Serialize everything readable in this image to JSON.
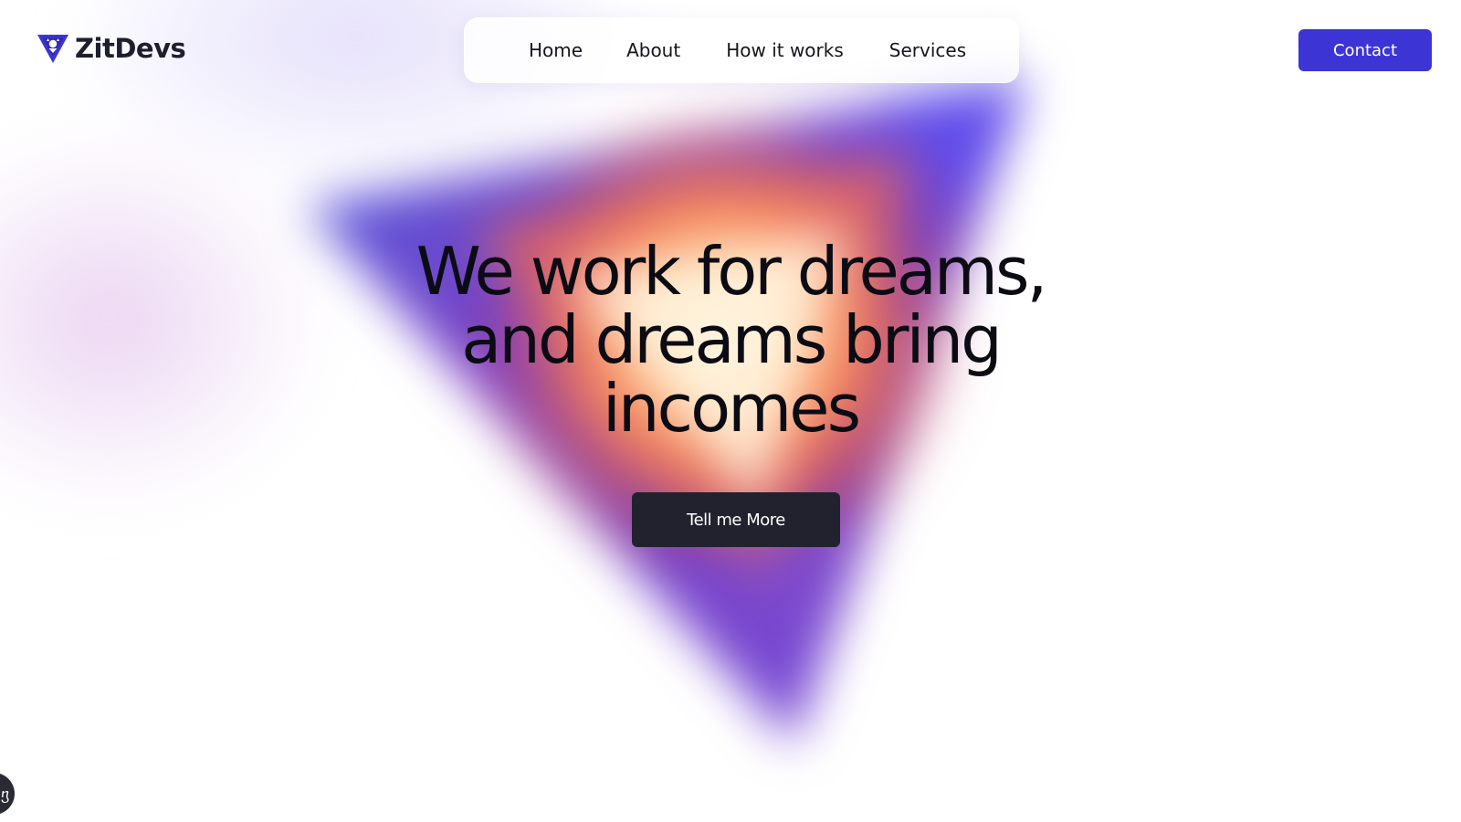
{
  "brand": {
    "name": "ZitDevs",
    "logo_icon": "inverted-triangle-logo-icon",
    "accent_color": "#3d34d6"
  },
  "nav": {
    "items": [
      {
        "label": "Home"
      },
      {
        "label": "About"
      },
      {
        "label": "How it works"
      },
      {
        "label": "Services"
      }
    ]
  },
  "header": {
    "contact_label": "Contact"
  },
  "hero": {
    "headline_lines": [
      "We work for dreams,",
      "and dreams bring",
      "incomes"
    ],
    "cta_label": "Tell me More"
  },
  "floating_widget": {
    "icon": "chat-icon",
    "glyph": "ⴂ"
  },
  "colors": {
    "text_dark": "#0b0b14",
    "cta_background": "#22222f",
    "gradient": [
      "#4a5be0",
      "#7a3cc0",
      "#f06a4a",
      "#f7c27a",
      "#5b3fd6"
    ]
  }
}
